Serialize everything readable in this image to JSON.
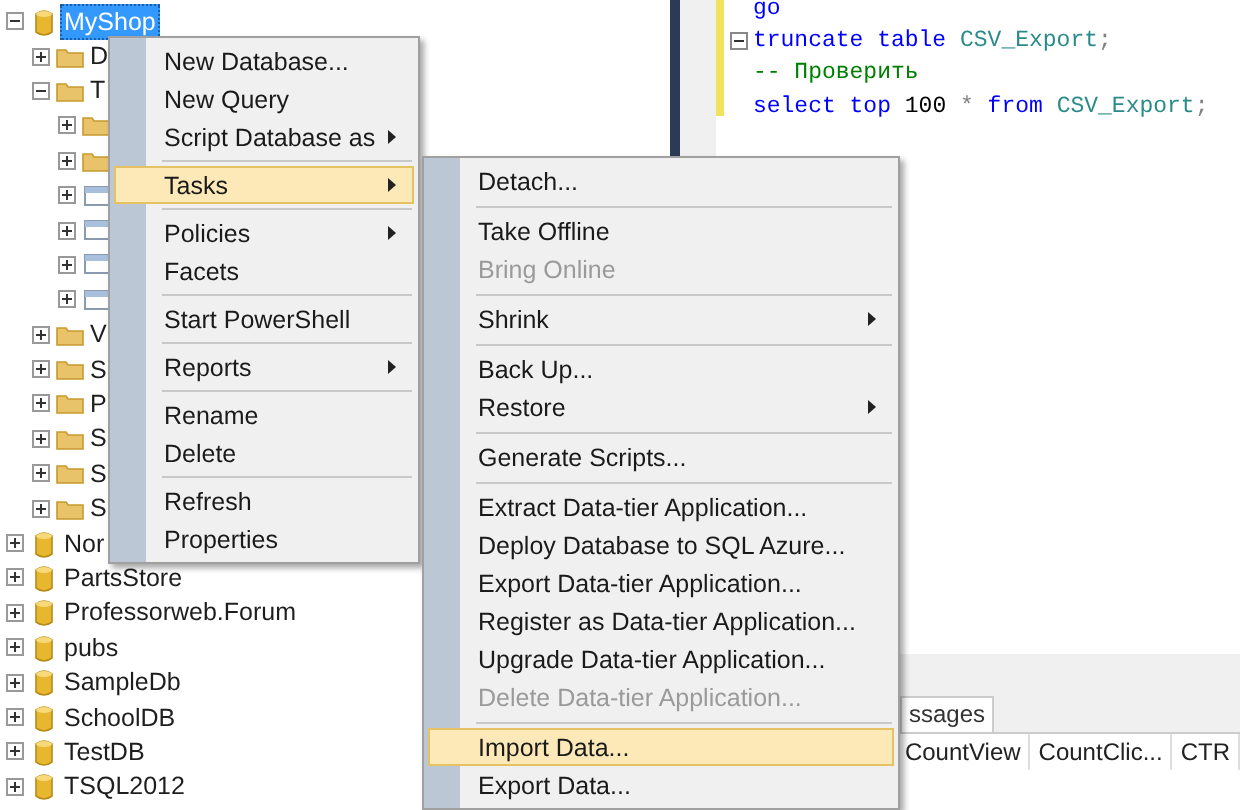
{
  "object_explorer": {
    "items": [
      {
        "label": "MyShop",
        "kind": "database",
        "expanded": true,
        "selected": true,
        "children": [
          {
            "label": "D",
            "kind": "folder",
            "expanded": false,
            "selected": false
          },
          {
            "label": "T",
            "kind": "folder",
            "expanded": true,
            "selected": false,
            "children": [
              {
                "kind": "folder",
                "expanded": false,
                "selected": false
              },
              {
                "kind": "folder",
                "expanded": false,
                "selected": false
              },
              {
                "kind": "table",
                "expanded": false,
                "selected": false
              },
              {
                "kind": "table",
                "expanded": false,
                "selected": false
              },
              {
                "kind": "table",
                "expanded": false,
                "selected": false
              },
              {
                "kind": "table",
                "expanded": false,
                "selected": false
              }
            ]
          },
          {
            "label": "V",
            "kind": "folder",
            "expanded": false,
            "selected": false
          },
          {
            "label": "S",
            "kind": "folder",
            "expanded": false,
            "selected": false
          },
          {
            "label": "P",
            "kind": "folder",
            "expanded": false,
            "selected": false
          },
          {
            "label": "S",
            "kind": "folder",
            "expanded": false,
            "selected": false
          },
          {
            "label": "S",
            "kind": "folder",
            "expanded": false,
            "selected": false
          },
          {
            "label": "S",
            "kind": "folder",
            "expanded": false,
            "selected": false
          }
        ]
      },
      {
        "label": "Nor",
        "kind": "database",
        "expanded": false,
        "selected": false
      },
      {
        "label": "PartsStore",
        "kind": "database",
        "expanded": false,
        "selected": false
      },
      {
        "label": "Professorweb.Forum",
        "kind": "database",
        "expanded": false,
        "selected": false
      },
      {
        "label": "pubs",
        "kind": "database",
        "expanded": false,
        "selected": false
      },
      {
        "label": "SampleDb",
        "kind": "database",
        "expanded": false,
        "selected": false
      },
      {
        "label": "SchoolDB",
        "kind": "database",
        "expanded": false,
        "selected": false
      },
      {
        "label": "TestDB",
        "kind": "database",
        "expanded": false,
        "selected": false
      },
      {
        "label": "TSQL2012",
        "kind": "database",
        "expanded": false,
        "selected": false
      }
    ]
  },
  "editor": {
    "lines": [
      {
        "collapsible": false,
        "tokens": [
          {
            "text": "go",
            "kind": "keyword"
          }
        ]
      },
      {
        "collapsible": true,
        "tokens": [
          {
            "text": "truncate table",
            "kind": "keyword"
          },
          {
            "text": " CSV_Export",
            "kind": "ident"
          },
          {
            "text": ";",
            "kind": "op"
          }
        ]
      },
      {
        "collapsible": false,
        "tokens": [
          {
            "text": "-- Проверить",
            "kind": "comment"
          }
        ]
      },
      {
        "collapsible": false,
        "tokens": [
          {
            "text": "select top",
            "kind": "keyword"
          },
          {
            "text": " 100 ",
            "kind": "number"
          },
          {
            "text": "*",
            "kind": "op"
          },
          {
            "text": " from",
            "kind": "keyword"
          },
          {
            "text": " CSV_Export",
            "kind": "ident"
          },
          {
            "text": ";",
            "kind": "op"
          }
        ]
      }
    ]
  },
  "results": {
    "tabs": [
      {
        "label": "ssages",
        "selected": true
      }
    ],
    "columns": [
      "CountView",
      "CountClic...",
      "CTR"
    ]
  },
  "context_menu": {
    "items": [
      {
        "kind": "item",
        "label": "New Database...",
        "submenu": false,
        "highlighted": false,
        "disabled": false
      },
      {
        "kind": "item",
        "label": "New Query",
        "submenu": false,
        "highlighted": false,
        "disabled": false
      },
      {
        "kind": "item",
        "label": "Script Database as",
        "submenu": true,
        "highlighted": false,
        "disabled": false
      },
      {
        "kind": "separator"
      },
      {
        "kind": "item",
        "label": "Tasks",
        "submenu": true,
        "highlighted": true,
        "disabled": false
      },
      {
        "kind": "separator"
      },
      {
        "kind": "item",
        "label": "Policies",
        "submenu": true,
        "highlighted": false,
        "disabled": false
      },
      {
        "kind": "item",
        "label": "Facets",
        "submenu": false,
        "highlighted": false,
        "disabled": false
      },
      {
        "kind": "separator"
      },
      {
        "kind": "item",
        "label": "Start PowerShell",
        "submenu": false,
        "highlighted": false,
        "disabled": false
      },
      {
        "kind": "separator"
      },
      {
        "kind": "item",
        "label": "Reports",
        "submenu": true,
        "highlighted": false,
        "disabled": false
      },
      {
        "kind": "separator"
      },
      {
        "kind": "item",
        "label": "Rename",
        "submenu": false,
        "highlighted": false,
        "disabled": false
      },
      {
        "kind": "item",
        "label": "Delete",
        "submenu": false,
        "highlighted": false,
        "disabled": false
      },
      {
        "kind": "separator"
      },
      {
        "kind": "item",
        "label": "Refresh",
        "submenu": false,
        "highlighted": false,
        "disabled": false
      },
      {
        "kind": "item",
        "label": "Properties",
        "submenu": false,
        "highlighted": false,
        "disabled": false
      }
    ]
  },
  "tasks_submenu": {
    "items": [
      {
        "kind": "item",
        "label": "Detach...",
        "submenu": false,
        "highlighted": false,
        "disabled": false
      },
      {
        "kind": "separator"
      },
      {
        "kind": "item",
        "label": "Take Offline",
        "submenu": false,
        "highlighted": false,
        "disabled": false
      },
      {
        "kind": "item",
        "label": "Bring Online",
        "submenu": false,
        "highlighted": false,
        "disabled": true
      },
      {
        "kind": "separator"
      },
      {
        "kind": "item",
        "label": "Shrink",
        "submenu": true,
        "highlighted": false,
        "disabled": false
      },
      {
        "kind": "separator"
      },
      {
        "kind": "item",
        "label": "Back Up...",
        "submenu": false,
        "highlighted": false,
        "disabled": false
      },
      {
        "kind": "item",
        "label": "Restore",
        "submenu": true,
        "highlighted": false,
        "disabled": false
      },
      {
        "kind": "separator"
      },
      {
        "kind": "item",
        "label": "Generate Scripts...",
        "submenu": false,
        "highlighted": false,
        "disabled": false
      },
      {
        "kind": "separator"
      },
      {
        "kind": "item",
        "label": "Extract Data-tier Application...",
        "submenu": false,
        "highlighted": false,
        "disabled": false
      },
      {
        "kind": "item",
        "label": "Deploy Database to SQL Azure...",
        "submenu": false,
        "highlighted": false,
        "disabled": false
      },
      {
        "kind": "item",
        "label": "Export Data-tier Application...",
        "submenu": false,
        "highlighted": false,
        "disabled": false
      },
      {
        "kind": "item",
        "label": "Register as Data-tier Application...",
        "submenu": false,
        "highlighted": false,
        "disabled": false
      },
      {
        "kind": "item",
        "label": "Upgrade Data-tier Application...",
        "submenu": false,
        "highlighted": false,
        "disabled": false
      },
      {
        "kind": "item",
        "label": "Delete Data-tier Application...",
        "submenu": false,
        "highlighted": false,
        "disabled": true
      },
      {
        "kind": "separator"
      },
      {
        "kind": "item",
        "label": "Import Data...",
        "submenu": false,
        "highlighted": true,
        "disabled": false
      },
      {
        "kind": "item",
        "label": "Export Data...",
        "submenu": false,
        "highlighted": false,
        "disabled": false
      }
    ]
  }
}
